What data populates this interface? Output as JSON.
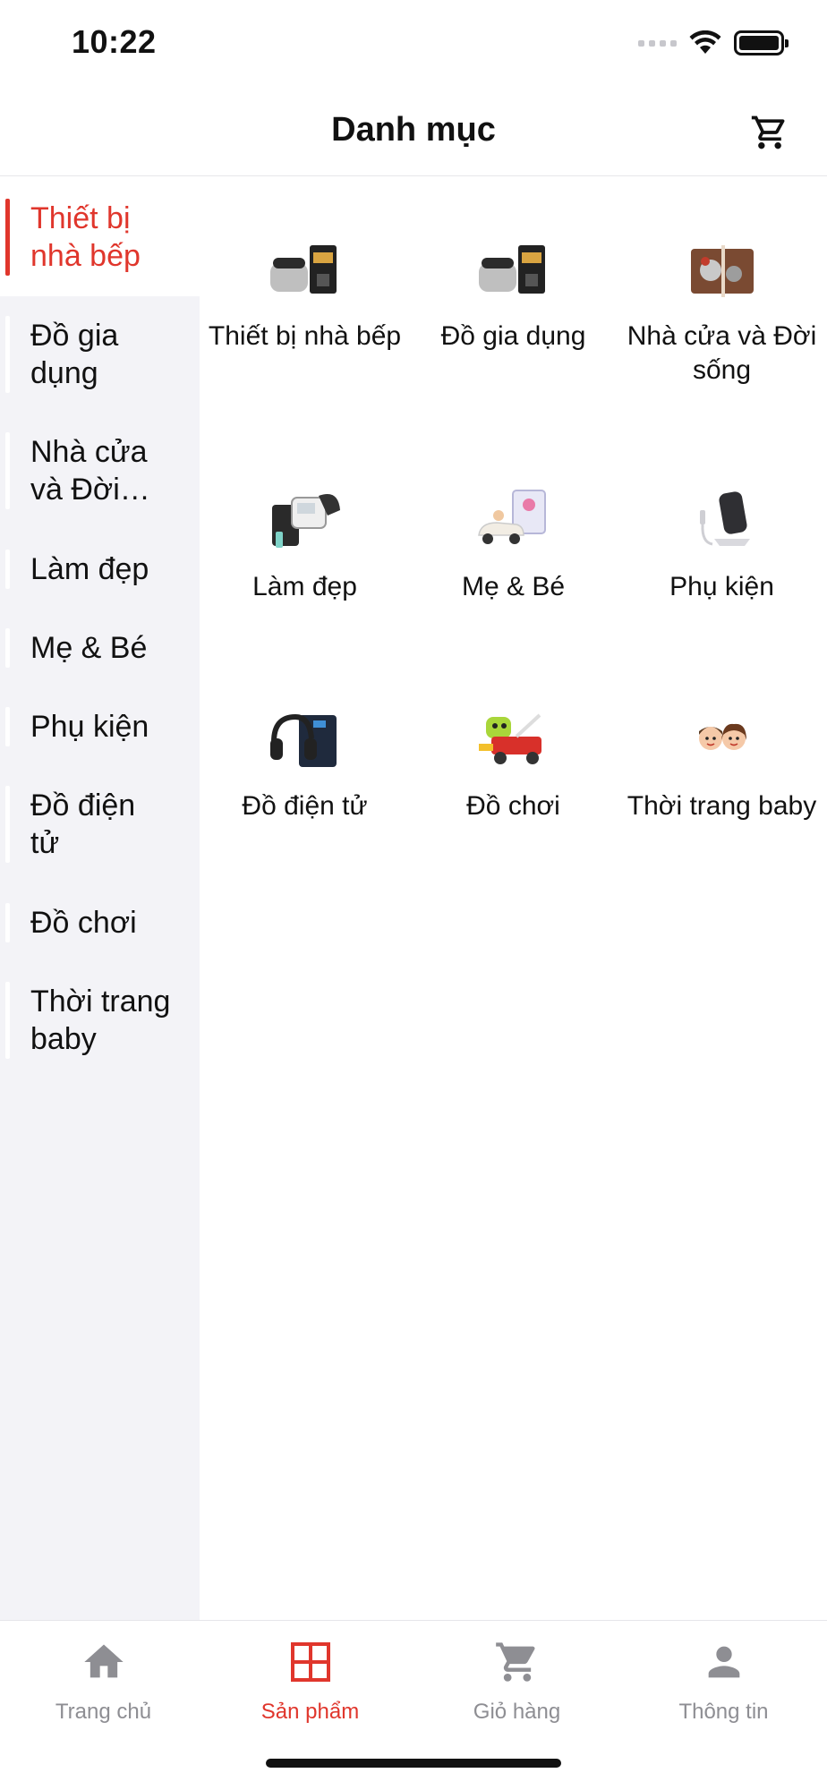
{
  "status": {
    "time": "10:22"
  },
  "header": {
    "title": "Danh mục"
  },
  "sidebar": {
    "items": [
      {
        "label": "Thiết bị nhà bếp",
        "active": true
      },
      {
        "label": "Đồ gia dụng",
        "active": false
      },
      {
        "label": "Nhà cửa và Đời sống",
        "active": false
      },
      {
        "label": "Làm đẹp",
        "active": false
      },
      {
        "label": "Mẹ & Bé",
        "active": false
      },
      {
        "label": "Phụ kiện",
        "active": false
      },
      {
        "label": "Đồ điện tử",
        "active": false
      },
      {
        "label": "Đồ chơi",
        "active": false
      },
      {
        "label": "Thời trang baby",
        "active": false
      }
    ]
  },
  "grid": {
    "items": [
      {
        "label": "Thiết bị nhà bếp",
        "icon": "kitchen-appliance-icon"
      },
      {
        "label": "Đồ gia dụng",
        "icon": "household-appliance-icon"
      },
      {
        "label": "Nhà cửa và Đời sống",
        "icon": "home-living-icon"
      },
      {
        "label": "Làm đẹp",
        "icon": "beauty-device-icon"
      },
      {
        "label": "Mẹ & Bé",
        "icon": "mom-baby-icon"
      },
      {
        "label": "Phụ kiện",
        "icon": "accessory-charger-icon"
      },
      {
        "label": "Đồ điện tử",
        "icon": "electronics-headphone-icon"
      },
      {
        "label": "Đồ chơi",
        "icon": "toy-car-icon"
      },
      {
        "label": "Thời trang baby",
        "icon": "baby-fashion-icon"
      }
    ]
  },
  "tabbar": {
    "tabs": [
      {
        "label": "Trang chủ",
        "icon": "home-icon",
        "active": false
      },
      {
        "label": "Sản phẩm",
        "icon": "grid-icon",
        "active": true
      },
      {
        "label": "Giỏ hàng",
        "icon": "cart-icon",
        "active": false
      },
      {
        "label": "Thông tin",
        "icon": "person-icon",
        "active": false
      }
    ]
  },
  "colors": {
    "accent": "#e0362c",
    "sidebar_bg": "#f3f3f7",
    "inactive_tab": "#8e8e93"
  }
}
